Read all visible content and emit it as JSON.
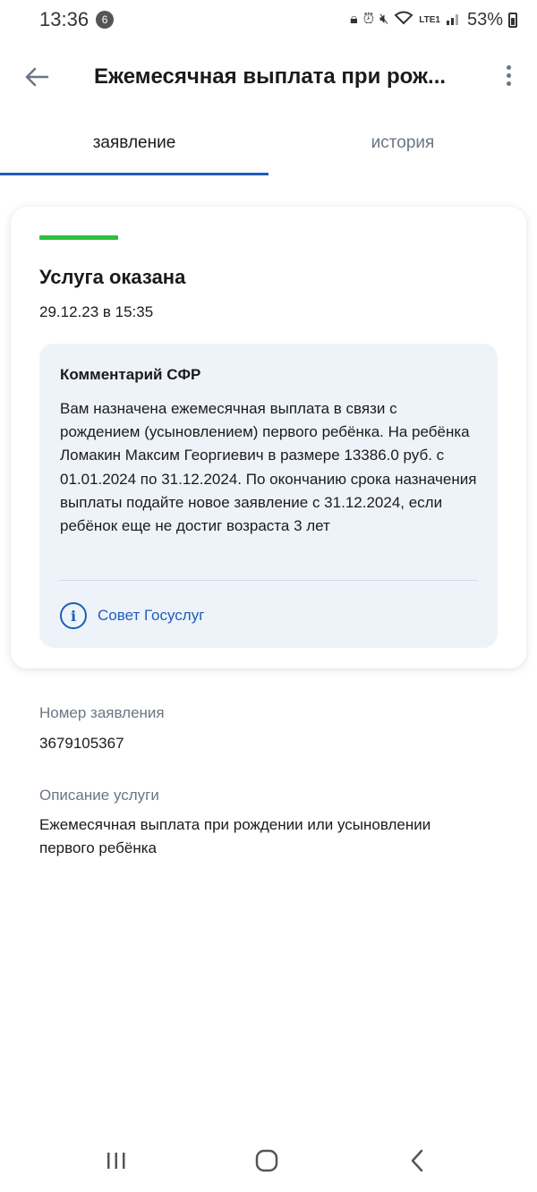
{
  "status_bar": {
    "time": "13:36",
    "notification_count": "6",
    "battery": "53%",
    "network": "LTE1"
  },
  "app_bar": {
    "title": "Ежемесячная выплата при рож..."
  },
  "tabs": [
    {
      "label": "заявление",
      "active": true
    },
    {
      "label": "история",
      "active": false
    }
  ],
  "status_card": {
    "status_color": "#2fbf3f",
    "status_title": "Услуга оказана",
    "status_date": "29.12.23 в 15:35",
    "comment": {
      "title": "Комментарий СФР",
      "text": "Вам назначена ежемесячная выплата в связи с рождением (усыновлением) первого ребёнка. На ребёнка Ломакин Максим Георгиевич в размере 13386.0 руб. с 01.01.2024 по 31.12.2024. По окончанию срока назначения выплаты подайте новое заявление с 31.12.2024, если ребёнок еще не достиг возраста 3 лет",
      "advice_link": "Совет Госуслуг"
    }
  },
  "application_number": {
    "label": "Номер заявления",
    "value": "3679105367"
  },
  "service_description": {
    "label": "Описание услуги",
    "value": "Ежемесячная выплата при рождении или усыновлении первого ребёнка"
  },
  "accent_color": "#1e5db8"
}
